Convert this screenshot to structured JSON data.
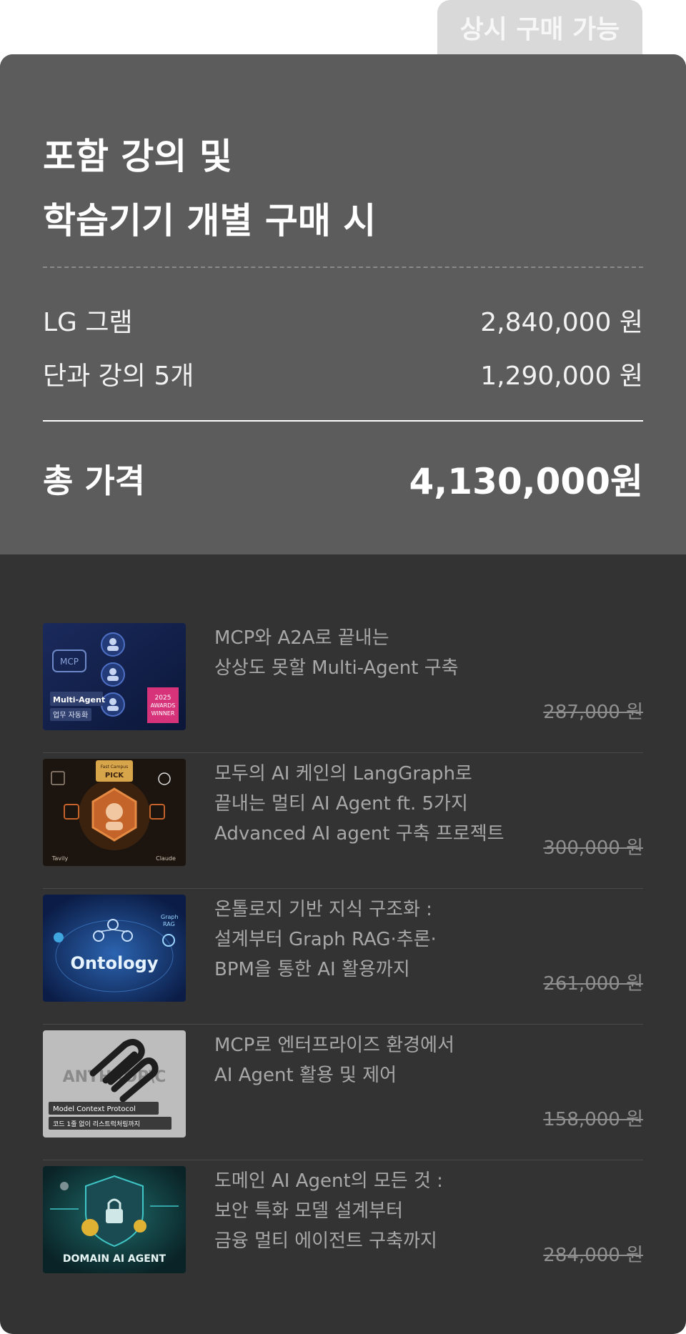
{
  "tab_label": "상시 구매 가능",
  "summary": {
    "title_lines": [
      "포함 강의 및",
      "학습기기 개별 구매 시"
    ],
    "lines": [
      {
        "label": "LG 그램",
        "value": "2,840,000 원"
      },
      {
        "label": "단과 강의 5개",
        "value": "1,290,000 원"
      }
    ],
    "total_label": "총 가격",
    "total_value": "4,130,000원"
  },
  "courses": [
    {
      "title_lines": [
        "MCP와 A2A로 끝내는",
        "상상도 못할 Multi-Agent 구축"
      ],
      "price": "287,000 원",
      "thumb_text": [
        "MCP",
        "Multi-Agent",
        "업무 자동화",
        "2025",
        "AWARDS",
        "WINNER"
      ],
      "icon": "multi-agent-thumbnail-icon"
    },
    {
      "title_lines": [
        "모두의 AI 케인의 LangGraph로",
        "끝내는 멀티 AI Agent ft. 5가지",
        "Advanced AI agent 구축 프로젝트"
      ],
      "price": "300,000 원",
      "thumb_text": [
        "Fast Campus",
        "PICK",
        "Tavily",
        "Claude"
      ],
      "icon": "langgraph-thumbnail-icon"
    },
    {
      "title_lines": [
        "온톨로지 기반 지식 구조화 :",
        "설계부터 Graph RAG·추론·",
        "BPM을 통한 AI 활용까지"
      ],
      "price": "261,000 원",
      "thumb_text": [
        "Ontology",
        "Graph",
        "RAG"
      ],
      "icon": "ontology-thumbnail-icon"
    },
    {
      "title_lines": [
        "MCP로 엔터프라이즈 환경에서",
        "AI Agent 활용 및 제어"
      ],
      "price": "158,000 원",
      "thumb_text": [
        "ANTHROP\\C",
        "Model Context Protocol",
        "코드 1줄 없이 리스트럭처링까지"
      ],
      "icon": "mcp-enterprise-thumbnail-icon"
    },
    {
      "title_lines": [
        "도메인 AI Agent의 모든 것 :",
        "보안 특화 모델 설계부터",
        "금융 멀티 에이전트 구축까지"
      ],
      "price": "284,000 원",
      "thumb_text": [
        "DOMAIN AI AGENT"
      ],
      "icon": "domain-ai-agent-thumbnail-icon"
    }
  ]
}
